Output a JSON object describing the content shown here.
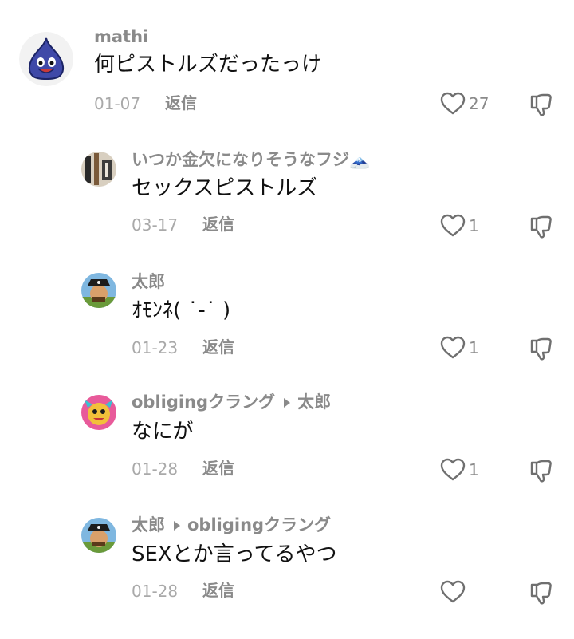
{
  "comments": [
    {
      "username": "mathi",
      "reply_to": "",
      "text": "何ピストルズだったっけ",
      "date": "01-07",
      "reply_label": "返信",
      "likes": "27",
      "avatar_icon": "slime-avatar-icon"
    },
    {
      "username": "いつか金欠になりそうなフジ🗻",
      "reply_to": "",
      "text": "セックスピストルズ",
      "date": "03-17",
      "reply_label": "返信",
      "likes": "1",
      "avatar_icon": "photo-avatar-icon"
    },
    {
      "username": "太郎",
      "reply_to": "",
      "text": "ｵﾓﾝﾈ( ˙-˙ )",
      "date": "01-23",
      "reply_label": "返信",
      "likes": "1",
      "avatar_icon": "pirate-avatar-icon"
    },
    {
      "username": "obligingクラング",
      "reply_to": "太郎",
      "text": "なにが",
      "date": "01-28",
      "reply_label": "返信",
      "likes": "1",
      "avatar_icon": "cartoon-avatar-icon"
    },
    {
      "username": "太郎",
      "reply_to": "obligingクラング",
      "text": "SEXとか言ってるやつ",
      "date": "01-28",
      "reply_label": "返信",
      "likes": "",
      "avatar_icon": "pirate-avatar-icon"
    }
  ],
  "colors": {
    "username": "#8a8a8a",
    "body_text": "#111111",
    "meta": "#a9a9a9",
    "icon_stroke": "#6f6f6f"
  }
}
